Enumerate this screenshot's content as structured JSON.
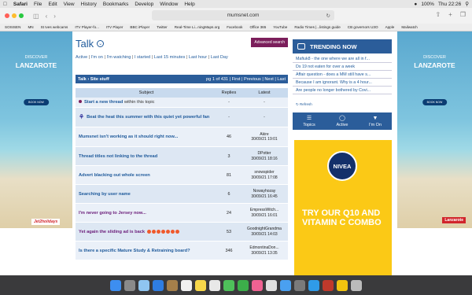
{
  "menubar": {
    "apple": "",
    "app": "Safari",
    "items": [
      "File",
      "Edit",
      "View",
      "History",
      "Bookmarks",
      "Develop",
      "Window",
      "Help"
    ],
    "battery": "100%",
    "clock": "Thu 22:26"
  },
  "toolbar": {
    "url": "mumsnet.com"
  },
  "bookmarks": [
    "SOSISEN",
    "MN",
    "St Ives webcams",
    "ITV Player-fo...",
    "ITV Player",
    "BBC iPlayer",
    "Twitter",
    "Real-Time Li...ningMaps.org",
    "Facebook",
    "Office 365",
    "YouTube",
    "Radio Times |...listings guide",
    "CB governors U3O",
    "Apple",
    "Mailwatch"
  ],
  "ad_left": {
    "line1": "DISCOVER",
    "line2": "LANZAROTE",
    "button": "BOOK NOW",
    "logo": "Jet2holidays"
  },
  "ad_right": {
    "line1": "DISCOVER",
    "line2": "LANZAROTE",
    "button": "BOOK NOW",
    "logo": "Lanzarote"
  },
  "main": {
    "title": "Talk",
    "advanced": "Advanced search",
    "filters": [
      "Active",
      "I'm on",
      "I'm watching",
      "I started",
      "Last 15 minutes",
      "Last hour",
      "Last Day"
    ],
    "breadcrumb": "Talk › Site stuff",
    "pagination": "pg 1 of 431 | First | Previous | Next | Last",
    "headers": {
      "subject": "Subject",
      "replies": "Replies",
      "latest": "Latest"
    },
    "start_thread": "Start a new thread",
    "start_thread_suffix": " within this topic",
    "rows": [
      {
        "title": "Beat the heat this summer with this quiet yet powerful fan",
        "replies": "-",
        "latest_name": "-",
        "latest_time": ""
      },
      {
        "title": "Mumsnet isn't working as it should right now...",
        "replies": "46",
        "latest_name": "Akire",
        "latest_time": "30/09/21 19:01"
      },
      {
        "title": "Thread titles not linking to the thread",
        "replies": "3",
        "latest_name": "DPotter",
        "latest_time": "30/09/21 18:16"
      },
      {
        "title": "Advert blacking out whole screen",
        "replies": "81",
        "latest_name": "snowspider",
        "latest_time": "30/09/21 17:08"
      },
      {
        "title": "Searching by user name",
        "replies": "6",
        "latest_name": "Nowayhozay",
        "latest_time": "30/09/21 16:45"
      },
      {
        "title": "I'm never going to Jersey now...",
        "replies": "24",
        "latest_name": "EmpressWitch...",
        "latest_time": "30/09/21 16:01"
      },
      {
        "title": "Yet again the sliding ad is back",
        "replies": "53",
        "latest_name": "GoodnightGrandma",
        "latest_time": "30/09/21 14:03"
      },
      {
        "title": "Is there a specific Mature Study & Retraining board?",
        "replies": "346",
        "latest_name": "EdmontinaDon...",
        "latest_time": "30/09/21 13:35"
      }
    ]
  },
  "sidebar": {
    "trending_title": "TRENDING NOW",
    "trending": [
      "Mafiuk8 - the one where we are all in f...",
      "Ds 19 not eaten for over a week",
      "Affair question - does a MM still have s...",
      "Because I am ignorant. Why is a 4 hour...",
      "Are people no longer bothered by Covi..."
    ],
    "refresh": "Refresh",
    "tabs": [
      "Topics",
      "Active",
      "I'm On"
    ]
  },
  "nivea": {
    "logo": "NIVEA",
    "text": "TRY OUR Q10 AND VITAMIN C COMBO"
  },
  "colors": {
    "accent": "#2b5d9a",
    "advanced": "#7b1e5b",
    "ad_yellow": "#fbc916"
  }
}
